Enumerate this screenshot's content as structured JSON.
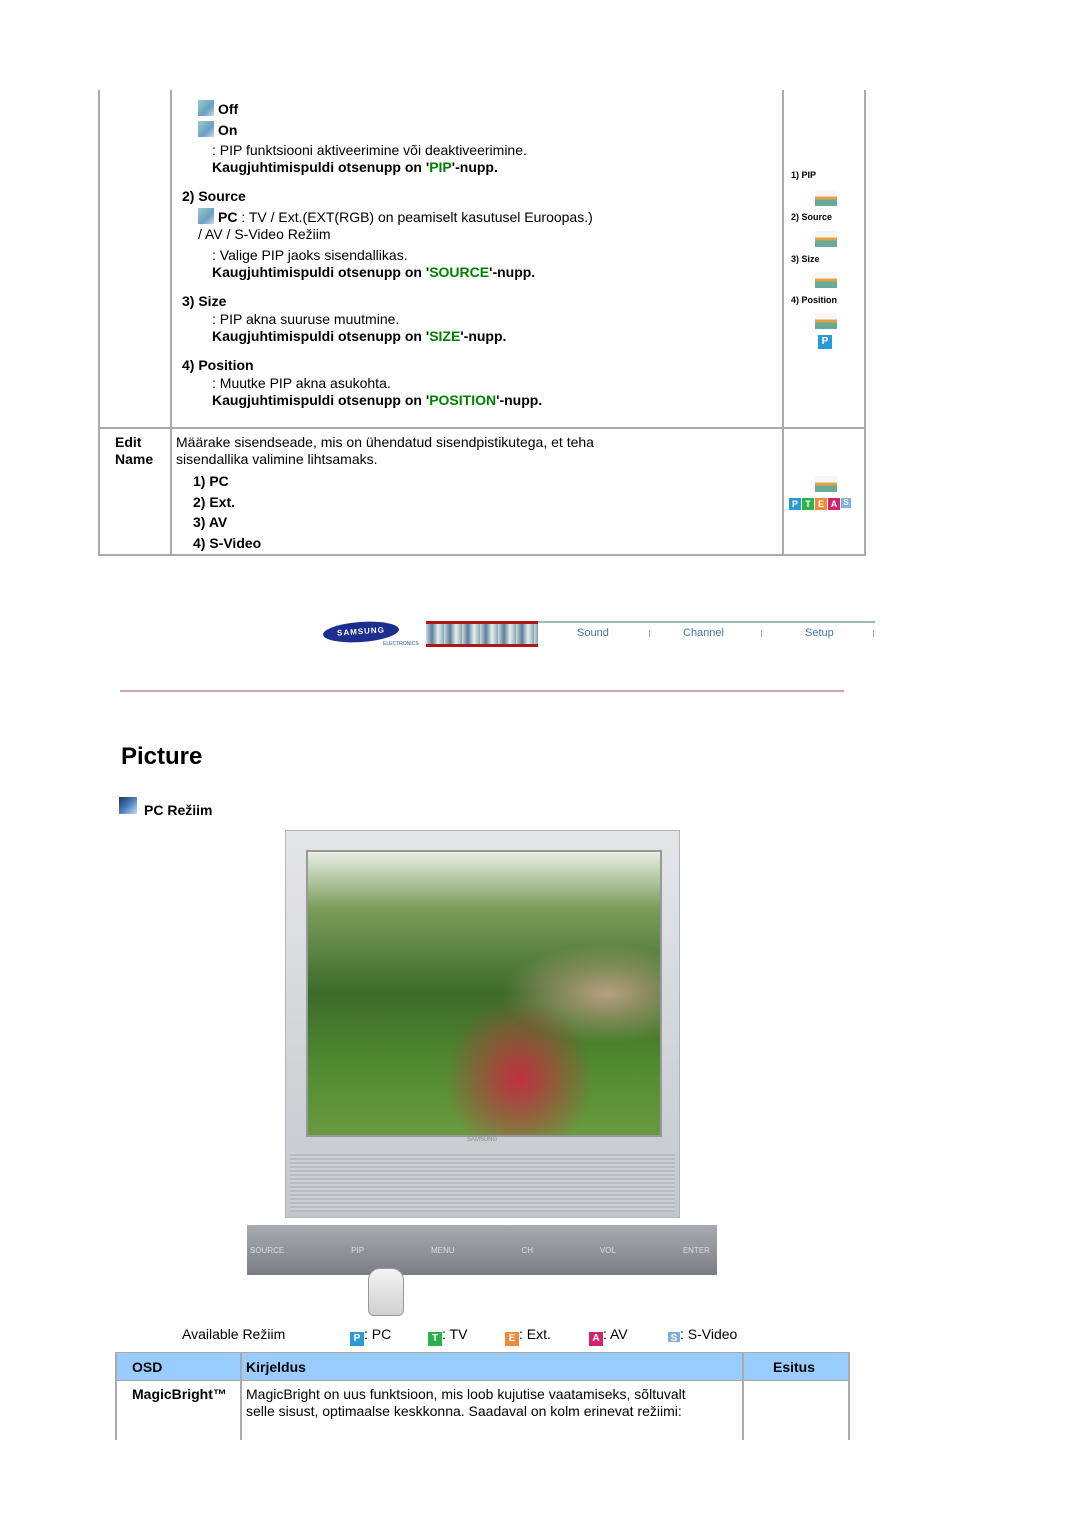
{
  "pip_table": {
    "rows": [
      {
        "label": "",
        "content": {
          "off": "Off",
          "on": "On",
          "pip_desc": ": PIP funktsiooni aktiveerimine või deaktiveerimine.",
          "pip_remote_pre": "Kaugjuhtimispuldi otsenupp on '",
          "pip_remote_key": "PIP",
          "pip_remote_post": "'-nupp.",
          "source_title": "2) Source",
          "source_pc": "PC",
          "source_line1": " : TV / Ext.(EXT(RGB) on peamiselt kasutusel Euroopas.)",
          "source_line2": "/ AV / S-Video Režiim",
          "source_desc": ": Valige PIP jaoks sisendallikas.",
          "source_remote_key": "SOURCE",
          "size_title": "3) Size",
          "size_desc": ": PIP akna suuruse muutmine.",
          "size_remote_key": "SIZE",
          "position_title": "4) Position",
          "position_desc": ": Muutke PIP akna asukohta.",
          "position_remote_key": "POSITION"
        },
        "side": [
          "1) PIP",
          "2) Source",
          "3) Size",
          "4) Position"
        ]
      },
      {
        "label_1": "Edit",
        "label_2": "Name",
        "desc_1": "Määrake sisendseade, mis on ühendatud sisendpistikutega, et teha",
        "desc_2": "sisendallika valimine lihtsamaks.",
        "items": [
          "1) PC",
          "2) Ext.",
          "3) AV",
          "4) S-Video"
        ]
      }
    ]
  },
  "nav": {
    "logo": "SAMSUNG",
    "logo_sub": "ELECTRONICS",
    "items": [
      "Sound",
      "Channel",
      "Setup"
    ]
  },
  "page_title": "Picture",
  "section_title": "PC Režiim",
  "monitor": {
    "brand": "SAMSUNG",
    "buttons": [
      "SOURCE",
      "PIP",
      "MENU",
      "CH",
      "VOL",
      "ENTER"
    ]
  },
  "available": {
    "label": "Available Režiim",
    "modes": [
      {
        "icon": "P",
        "text": ": PC",
        "color": "#2a9ad6"
      },
      {
        "icon": "T",
        "text": ": TV",
        "color": "#2bb24c"
      },
      {
        "icon": "E",
        "text": ": Ext.",
        "color": "#f08a3a"
      },
      {
        "icon": "A",
        "text": ": AV",
        "color": "#d2246a"
      },
      {
        "icon": "S",
        "text": ": S-Video",
        "color": "#7fb0e0"
      }
    ]
  },
  "osd_table": {
    "headers": [
      "OSD",
      "Kirjeldus",
      "Esitus"
    ],
    "header_bg": "#99ccff",
    "rows": [
      {
        "osd": "MagicBright™",
        "desc_1": "MagicBright on uus funktsioon, mis loob kujutise vaatamiseks, sõltuvalt",
        "desc_2": "selle sisust, optimaalse keskkonna. Saadaval on kolm erinevat režiimi:"
      }
    ]
  }
}
